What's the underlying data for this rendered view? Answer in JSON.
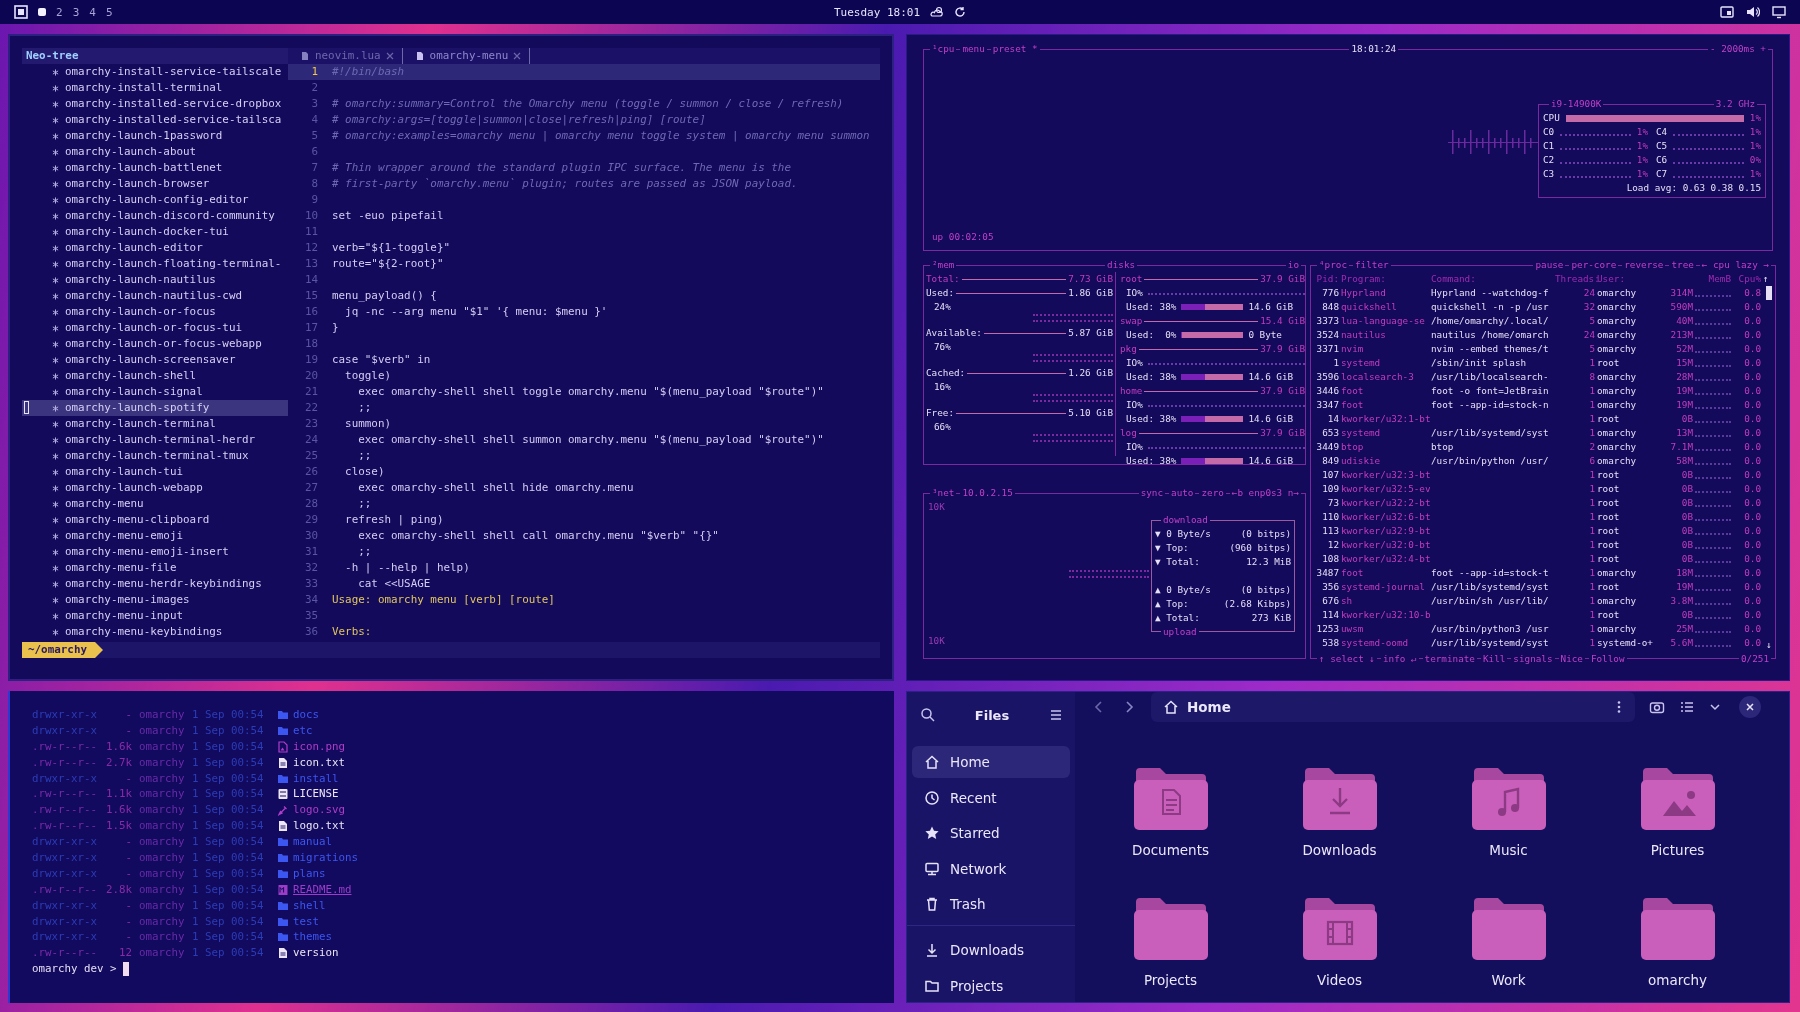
{
  "topbar": {
    "workspaces": [
      {
        "selected": true
      },
      {
        "label": "2",
        "selected": false
      },
      {
        "label": "3",
        "selected": false
      },
      {
        "label": "4",
        "selected": false
      },
      {
        "label": "5",
        "selected": false
      }
    ],
    "clock": "Tuesday 18:01"
  },
  "editor": {
    "tree_title": "Neo-tree",
    "tabs": [
      {
        "label": "neovim.lua",
        "selected": false
      },
      {
        "label": "omarchy-menu",
        "selected": true
      }
    ],
    "tree": [
      {
        "name": "omarchy-install-service-tailscale",
        "selected": false
      },
      {
        "name": "omarchy-install-terminal",
        "selected": false
      },
      {
        "name": "omarchy-installed-service-dropbox",
        "selected": false
      },
      {
        "name": "omarchy-installed-service-tailsca",
        "selected": false
      },
      {
        "name": "omarchy-launch-1password",
        "selected": false
      },
      {
        "name": "omarchy-launch-about",
        "selected": false
      },
      {
        "name": "omarchy-launch-battlenet",
        "selected": false
      },
      {
        "name": "omarchy-launch-browser",
        "selected": false
      },
      {
        "name": "omarchy-launch-config-editor",
        "selected": false
      },
      {
        "name": "omarchy-launch-discord-community",
        "selected": false
      },
      {
        "name": "omarchy-launch-docker-tui",
        "selected": false
      },
      {
        "name": "omarchy-launch-editor",
        "selected": false
      },
      {
        "name": "omarchy-launch-floating-terminal-",
        "selected": false
      },
      {
        "name": "omarchy-launch-nautilus",
        "selected": false
      },
      {
        "name": "omarchy-launch-nautilus-cwd",
        "selected": false
      },
      {
        "name": "omarchy-launch-or-focus",
        "selected": false
      },
      {
        "name": "omarchy-launch-or-focus-tui",
        "selected": false
      },
      {
        "name": "omarchy-launch-or-focus-webapp",
        "selected": false
      },
      {
        "name": "omarchy-launch-screensaver",
        "selected": false
      },
      {
        "name": "omarchy-launch-shell",
        "selected": false
      },
      {
        "name": "omarchy-launch-signal",
        "selected": false
      },
      {
        "name": "omarchy-launch-spotify",
        "selected": true
      },
      {
        "name": "omarchy-launch-terminal",
        "selected": false
      },
      {
        "name": "omarchy-launch-terminal-herdr",
        "selected": false
      },
      {
        "name": "omarchy-launch-terminal-tmux",
        "selected": false
      },
      {
        "name": "omarchy-launch-tui",
        "selected": false
      },
      {
        "name": "omarchy-launch-webapp",
        "selected": false
      },
      {
        "name": "omarchy-menu",
        "selected": false
      },
      {
        "name": "omarchy-menu-clipboard",
        "selected": false
      },
      {
        "name": "omarchy-menu-emoji",
        "selected": false
      },
      {
        "name": "omarchy-menu-emoji-insert",
        "selected": false
      },
      {
        "name": "omarchy-menu-file",
        "selected": false
      },
      {
        "name": "omarchy-menu-herdr-keybindings",
        "selected": false
      },
      {
        "name": "omarchy-menu-images",
        "selected": false
      },
      {
        "name": "omarchy-menu-input",
        "selected": false
      },
      {
        "name": "omarchy-menu-keybindings",
        "selected": false
      }
    ],
    "lines": [
      {
        "n": "1",
        "text": "#!/bin/bash",
        "kind": "comment",
        "current": true
      },
      {
        "n": "2",
        "current": false
      },
      {
        "n": "3",
        "text": "# omarchy:summary=Control the Omarchy menu (toggle / summon / close / refresh)",
        "kind": "comment",
        "current": false
      },
      {
        "n": "4",
        "text": "# omarchy:args=[toggle|summon|close|refresh|ping] [route]",
        "kind": "comment",
        "current": false
      },
      {
        "n": "5",
        "text": "# omarchy:examples=omarchy menu | omarchy menu toggle system | omarchy menu summon",
        "kind": "comment",
        "current": false
      },
      {
        "n": "6",
        "current": false
      },
      {
        "n": "7",
        "text": "# Thin wrapper around the standard plugin IPC surface. The menu is the",
        "kind": "comment",
        "current": false
      },
      {
        "n": "8",
        "text": "# first-party `omarchy.menu` plugin; routes are passed as JSON payload.",
        "kind": "comment",
        "current": false
      },
      {
        "n": "9",
        "current": false
      },
      {
        "n": "10",
        "text": "set -euo pipefail",
        "kind": "code",
        "current": false
      },
      {
        "n": "11",
        "current": false
      },
      {
        "n": "12",
        "text": "verb=\"${1-toggle}\"",
        "kind": "code",
        "current": false
      },
      {
        "n": "13",
        "text": "route=\"${2-root}\"",
        "kind": "code",
        "current": false
      },
      {
        "n": "14",
        "current": false
      },
      {
        "n": "15",
        "text": "menu_payload() {",
        "kind": "code",
        "current": false
      },
      {
        "n": "16",
        "text": "  jq -nc --arg menu \"$1\" '{ menu: $menu }'",
        "kind": "code",
        "current": false
      },
      {
        "n": "17",
        "text": "}",
        "kind": "code",
        "current": false
      },
      {
        "n": "18",
        "current": false
      },
      {
        "n": "19",
        "text": "case \"$verb\" in",
        "kind": "code",
        "current": false
      },
      {
        "n": "20",
        "text": "  toggle)",
        "kind": "code",
        "current": false
      },
      {
        "n": "21",
        "text": "    exec omarchy-shell shell toggle omarchy.menu \"$(menu_payload \"$route\")\"",
        "kind": "code",
        "current": false
      },
      {
        "n": "22",
        "text": "    ;;",
        "kind": "code",
        "current": false
      },
      {
        "n": "23",
        "text": "  summon)",
        "kind": "code",
        "current": false
      },
      {
        "n": "24",
        "text": "    exec omarchy-shell shell summon omarchy.menu \"$(menu_payload \"$route\")\"",
        "kind": "code",
        "current": false
      },
      {
        "n": "25",
        "text": "    ;;",
        "kind": "code",
        "current": false
      },
      {
        "n": "26",
        "text": "  close)",
        "kind": "code",
        "current": false
      },
      {
        "n": "27",
        "text": "    exec omarchy-shell shell hide omarchy.menu",
        "kind": "code",
        "current": false
      },
      {
        "n": "28",
        "text": "    ;;",
        "kind": "code",
        "current": false
      },
      {
        "n": "29",
        "text": "  refresh | ping)",
        "kind": "code",
        "current": false
      },
      {
        "n": "30",
        "text": "    exec omarchy-shell shell call omarchy.menu \"$verb\" \"{}\"",
        "kind": "code",
        "current": false
      },
      {
        "n": "31",
        "text": "    ;;",
        "kind": "code",
        "current": false
      },
      {
        "n": "32",
        "text": "  -h | --help | help)",
        "kind": "code",
        "current": false
      },
      {
        "n": "33",
        "text": "    cat <<USAGE",
        "kind": "code",
        "current": false
      },
      {
        "n": "34",
        "text": "Usage: omarchy menu [verb] [route]",
        "kind": "heredoc",
        "current": false
      },
      {
        "n": "35",
        "current": false
      },
      {
        "n": "36",
        "text": "Verbs:",
        "kind": "heredoc",
        "current": false
      }
    ],
    "status": "~/omarchy"
  },
  "btop": {
    "cpu": {
      "tabs": [
        "¹cpu",
        "menu",
        "preset *"
      ],
      "clock": "18:01:24",
      "interval": "- 2000ms +",
      "uptime": "up 00:02:05",
      "model": "i9-14900K",
      "freq": "3.2 GHz",
      "total_label": "CPU",
      "total": "1%",
      "cores": [
        {
          "label": "C0",
          "reading": "1%"
        },
        {
          "label": "C1",
          "reading": "1%"
        },
        {
          "label": "C2",
          "reading": "1%"
        },
        {
          "label": "C3",
          "reading": "1%"
        },
        {
          "label": "C4",
          "reading": "1%"
        },
        {
          "label": "C5",
          "reading": "1%"
        },
        {
          "label": "C6",
          "reading": "0%"
        },
        {
          "label": "C7",
          "reading": "1%"
        }
      ],
      "load": "Load avg: 0.63 0.38 0.15"
    },
    "mem": {
      "title": "²mem",
      "rows": [
        {
          "label": "Total:",
          "value": "7.73 GiB"
        },
        {
          "label": "Used:",
          "value": "1.86 GiB",
          "percent": "24%"
        },
        {
          "label": "Available:",
          "value": "5.87 GiB",
          "percent": "76%"
        },
        {
          "label": "Cached:",
          "value": "1.26 GiB",
          "percent": "16%"
        },
        {
          "label": "Free:",
          "value": "5.10 GiB",
          "percent": "66%"
        }
      ]
    },
    "disks": {
      "title": "disks",
      "io_label": "io",
      "items": [
        {
          "name": "root",
          "size": "37.9 GiB",
          "io": "IO%",
          "used": "Used: 38%",
          "level": 0.38,
          "amount": "14.6 GiB"
        },
        {
          "name": "swap",
          "size": "15.4 GiB",
          "used": "Used:  0%",
          "level": 0,
          "amount": "0 Byte"
        },
        {
          "name": "pkg",
          "size": "37.9 GiB",
          "io": "IO%",
          "used": "Used: 38%",
          "level": 0.38,
          "amount": "14.6 GiB"
        },
        {
          "name": "home",
          "size": "37.9 GiB",
          "io": "IO%",
          "used": "Used: 38%",
          "level": 0.38,
          "amount": "14.6 GiB"
        },
        {
          "name": "log",
          "size": "37.9 GiB",
          "io": "IO%",
          "used": "Used: 38%",
          "level": 0.38,
          "amount": "14.6 GiB"
        }
      ]
    },
    "net": {
      "title": "³net",
      "address": "10.0.2.15",
      "buttons": [
        "sync",
        "auto",
        "zero",
        "←b enp0s3 n→"
      ],
      "scale_top": "10K",
      "scale_bottom": "10K",
      "download": {
        "title": "download",
        "rows": [
          {
            "label": "▼ 0 Byte/s",
            "value": "(0 bitps)"
          },
          {
            "label": "▼ Top:",
            "value": "(960 bitps)"
          },
          {
            "label": "▼ Total:",
            "value": "12.3 MiB"
          }
        ]
      },
      "upload": {
        "title": "upload",
        "rows": [
          {
            "label": "▲ 0 Byte/s",
            "value": "(0 bitps)"
          },
          {
            "label": "▲ Top:",
            "value": "(2.68 Kibps)"
          },
          {
            "label": "▲ Total:",
            "value": "273 KiB"
          }
        ]
      }
    },
    "proc": {
      "title": "⁴proc",
      "filter": "filter",
      "buttons": [
        "pause",
        "per-core",
        "reverse",
        "tree",
        "← cpu lazy →"
      ],
      "columns": [
        "Pid:",
        "Program:",
        "Command:",
        "Threads:",
        "User:",
        "MemB",
        "Cpu%"
      ],
      "scroll_up": "↑",
      "scroll_down": "↓",
      "rows": [
        {
          "pid": "776",
          "program": "Hyprland",
          "command": "Hyprland --watchdog-f",
          "threads": "24",
          "user": "omarchy",
          "mem": "314M",
          "cpu": "0.8"
        },
        {
          "pid": "848",
          "program": "quickshell",
          "command": "quickshell -n -p /usr",
          "threads": "32",
          "user": "omarchy",
          "mem": "590M",
          "cpu": "0.0"
        },
        {
          "pid": "3373",
          "program": "lua-language-se",
          "command": "/home/omarchy/.local/",
          "threads": "5",
          "user": "omarchy",
          "mem": "40M",
          "cpu": "0.0"
        },
        {
          "pid": "3524",
          "program": "nautilus",
          "command": "nautilus /home/omarch",
          "threads": "24",
          "user": "omarchy",
          "mem": "213M",
          "cpu": "0.0"
        },
        {
          "pid": "3371",
          "program": "nvim",
          "command": "nvim --embed themes/t",
          "threads": "5",
          "user": "omarchy",
          "mem": "52M",
          "cpu": "0.0"
        },
        {
          "pid": "1",
          "program": "systemd",
          "command": "/sbin/init splash",
          "threads": "1",
          "user": "root",
          "mem": "15M",
          "cpu": "0.0"
        },
        {
          "pid": "3596",
          "program": "localsearch-3",
          "command": "/usr/lib/localsearch-",
          "threads": "8",
          "user": "omarchy",
          "mem": "28M",
          "cpu": "0.0"
        },
        {
          "pid": "3446",
          "program": "foot",
          "command": "foot -o font=JetBrain",
          "threads": "1",
          "user": "omarchy",
          "mem": "19M",
          "cpu": "0.0"
        },
        {
          "pid": "3347",
          "program": "foot",
          "command": "foot --app-id=stock-n",
          "threads": "1",
          "user": "omarchy",
          "mem": "19M",
          "cpu": "0.0"
        },
        {
          "pid": "14",
          "program": "kworker/u32:1-bt",
          "threads": "1",
          "user": "root",
          "mem": "0B",
          "cpu": "0.0"
        },
        {
          "pid": "653",
          "program": "systemd",
          "command": "/usr/lib/systemd/syst",
          "threads": "1",
          "user": "omarchy",
          "mem": "13M",
          "cpu": "0.0"
        },
        {
          "pid": "3449",
          "program": "btop",
          "command": "btop",
          "threads": "2",
          "user": "omarchy",
          "mem": "7.1M",
          "cpu": "0.0"
        },
        {
          "pid": "849",
          "program": "udiskie",
          "command": "/usr/bin/python /usr/",
          "threads": "6",
          "user": "omarchy",
          "mem": "58M",
          "cpu": "0.0"
        },
        {
          "pid": "107",
          "program": "kworker/u32:3-bt",
          "threads": "1",
          "user": "root",
          "mem": "0B",
          "cpu": "0.0"
        },
        {
          "pid": "109",
          "program": "kworker/u32:5-ev",
          "threads": "1",
          "user": "root",
          "mem": "0B",
          "cpu": "0.0"
        },
        {
          "pid": "73",
          "program": "kworker/u32:2-bt",
          "threads": "1",
          "user": "root",
          "mem": "0B",
          "cpu": "0.0"
        },
        {
          "pid": "110",
          "program": "kworker/u32:6-bt",
          "threads": "1",
          "user": "root",
          "mem": "0B",
          "cpu": "0.0"
        },
        {
          "pid": "113",
          "program": "kworker/u32:9-bt",
          "threads": "1",
          "user": "root",
          "mem": "0B",
          "cpu": "0.0"
        },
        {
          "pid": "12",
          "program": "kworker/u32:0-bt",
          "threads": "1",
          "user": "root",
          "mem": "0B",
          "cpu": "0.0"
        },
        {
          "pid": "108",
          "program": "kworker/u32:4-bt",
          "threads": "1",
          "user": "root",
          "mem": "0B",
          "cpu": "0.0"
        },
        {
          "pid": "3487",
          "program": "foot",
          "command": "foot --app-id=stock-t",
          "threads": "1",
          "user": "omarchy",
          "mem": "18M",
          "cpu": "0.0"
        },
        {
          "pid": "356",
          "program": "systemd-journal",
          "command": "/usr/lib/systemd/syst",
          "threads": "1",
          "user": "root",
          "mem": "19M",
          "cpu": "0.0"
        },
        {
          "pid": "676",
          "program": "sh",
          "command": "/usr/bin/sh /usr/lib/",
          "threads": "1",
          "user": "omarchy",
          "mem": "3.8M",
          "cpu": "0.0"
        },
        {
          "pid": "114",
          "program": "kworker/u32:10-b",
          "threads": "1",
          "user": "root",
          "mem": "0B",
          "cpu": "0.0"
        },
        {
          "pid": "1253",
          "program": "uwsm",
          "command": "/usr/bin/python3 /usr",
          "threads": "1",
          "user": "omarchy",
          "mem": "25M",
          "cpu": "0.0"
        },
        {
          "pid": "538",
          "program": "systemd-oomd",
          "command": "/usr/lib/systemd/syst",
          "threads": "1",
          "user": "systemd-o+",
          "mem": "5.6M",
          "cpu": "0.0"
        }
      ],
      "footer": [
        "↑ select ↓",
        "info ↵",
        "terminate",
        "Kill",
        "signals",
        "Nice",
        "Follow"
      ],
      "count": "0/251"
    }
  },
  "terminal": {
    "entries": [
      {
        "perms": "drwxr-xr-x",
        "size": "-",
        "user": "omarchy",
        "date": "1 Sep 00:54",
        "name": "docs",
        "kind": "dir"
      },
      {
        "perms": "drwxr-xr-x",
        "size": "-",
        "user": "omarchy",
        "date": "1 Sep 00:54",
        "name": "etc",
        "kind": "dir"
      },
      {
        "perms": ".rw-r--r--",
        "size": "1.6k",
        "user": "omarchy",
        "date": "1 Sep 00:54",
        "name": "icon.png",
        "kind": "image"
      },
      {
        "perms": ".rw-r--r--",
        "size": "2.7k",
        "user": "omarchy",
        "date": "1 Sep 00:54",
        "name": "icon.txt",
        "kind": "text"
      },
      {
        "perms": "drwxr-xr-x",
        "size": "-",
        "user": "omarchy",
        "date": "1 Sep 00:54",
        "name": "install",
        "kind": "dir"
      },
      {
        "perms": ".rw-r--r--",
        "size": "1.1k",
        "user": "omarchy",
        "date": "1 Sep 00:54",
        "name": "LICENSE",
        "kind": "license"
      },
      {
        "perms": ".rw-r--r--",
        "size": "1.6k",
        "user": "omarchy",
        "date": "1 Sep 00:54",
        "name": "logo.svg",
        "kind": "vector"
      },
      {
        "perms": ".rw-r--r--",
        "size": "1.5k",
        "user": "omarchy",
        "date": "1 Sep 00:54",
        "name": "logo.txt",
        "kind": "text"
      },
      {
        "perms": "drwxr-xr-x",
        "size": "-",
        "user": "omarchy",
        "date": "1 Sep 00:54",
        "name": "manual",
        "kind": "dir"
      },
      {
        "perms": "drwxr-xr-x",
        "size": "-",
        "user": "omarchy",
        "date": "1 Sep 00:54",
        "name": "migrations",
        "kind": "dir"
      },
      {
        "perms": "drwxr-xr-x",
        "size": "-",
        "user": "omarchy",
        "date": "1 Sep 00:54",
        "name": "plans",
        "kind": "dir"
      },
      {
        "perms": ".rw-r--r--",
        "size": "2.8k",
        "user": "omarchy",
        "date": "1 Sep 00:54",
        "name": "README.md",
        "kind": "markdown"
      },
      {
        "perms": "drwxr-xr-x",
        "size": "-",
        "user": "omarchy",
        "date": "1 Sep 00:54",
        "name": "shell",
        "kind": "dir"
      },
      {
        "perms": "drwxr-xr-x",
        "size": "-",
        "user": "omarchy",
        "date": "1 Sep 00:54",
        "name": "test",
        "kind": "dir"
      },
      {
        "perms": "drwxr-xr-x",
        "size": "-",
        "user": "omarchy",
        "date": "1 Sep 00:54",
        "name": "themes",
        "kind": "dir"
      },
      {
        "perms": ".rw-r--r--",
        "size": "12",
        "user": "omarchy",
        "date": "1 Sep 00:54",
        "name": "version",
        "kind": "text"
      }
    ],
    "prompt": "omarchy dev >"
  },
  "files": {
    "title": "Files",
    "path": "Home",
    "places": [
      {
        "label": "Home",
        "selected": true
      },
      {
        "label": "Recent",
        "selected": false
      },
      {
        "label": "Starred",
        "selected": false
      },
      {
        "label": "Network",
        "selected": false
      },
      {
        "label": "Trash",
        "selected": false
      }
    ],
    "bookmarks": [
      {
        "label": "Downloads",
        "selected": false
      },
      {
        "label": "Projects",
        "selected": false
      }
    ],
    "folders": [
      {
        "label": "Documents"
      },
      {
        "label": "Downloads"
      },
      {
        "label": "Music"
      },
      {
        "label": "Pictures"
      },
      {
        "label": "Projects"
      },
      {
        "label": "Videos"
      },
      {
        "label": "Work"
      },
      {
        "label": "omarchy"
      }
    ]
  }
}
